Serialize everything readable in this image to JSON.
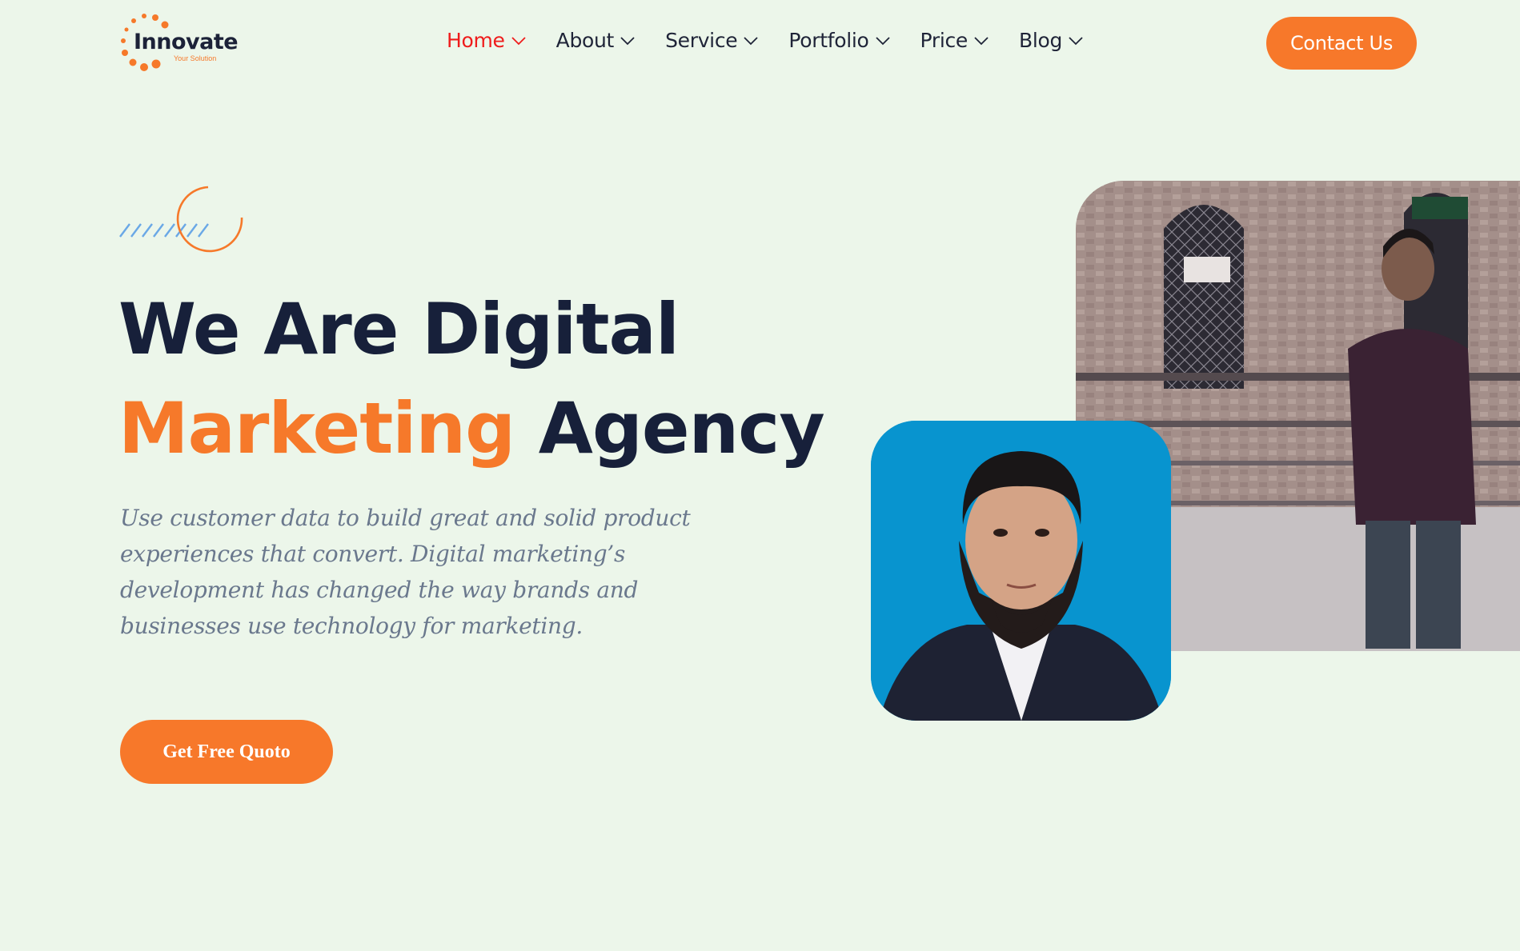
{
  "brand": {
    "name": "Innovate",
    "tagline": "Your Solution",
    "colors": {
      "accent": "#f6792a",
      "active_nav": "#ef1c1c",
      "heading": "#17203a",
      "background": "#ecf6ea",
      "body_text": "#6a788d"
    }
  },
  "nav": {
    "items": [
      {
        "label": "Home",
        "active": true,
        "icon": "chevron-down-icon"
      },
      {
        "label": "About",
        "active": false,
        "icon": "chevron-down-icon"
      },
      {
        "label": "Service",
        "active": false,
        "icon": "chevron-down-icon"
      },
      {
        "label": "Portfolio",
        "active": false,
        "icon": "chevron-down-icon"
      },
      {
        "label": "Price",
        "active": false,
        "icon": "chevron-down-icon"
      },
      {
        "label": "Blog",
        "active": false,
        "icon": "chevron-down-icon"
      }
    ],
    "cta_label": "Contact Us"
  },
  "hero": {
    "title_line1": "We Are Digital",
    "title_accent": "Marketing",
    "title_rest": "Agency",
    "description": "Use customer data to build great and solid product experiences that convert. Digital marketing’s development has changed the way brands and businesses use technology for marketing.",
    "cta_label": "Get Free Quoto"
  },
  "images": {
    "large_photo": "man-standing-in-front-of-mosque-photo",
    "small_photo": "portrait-headshot-photo"
  }
}
